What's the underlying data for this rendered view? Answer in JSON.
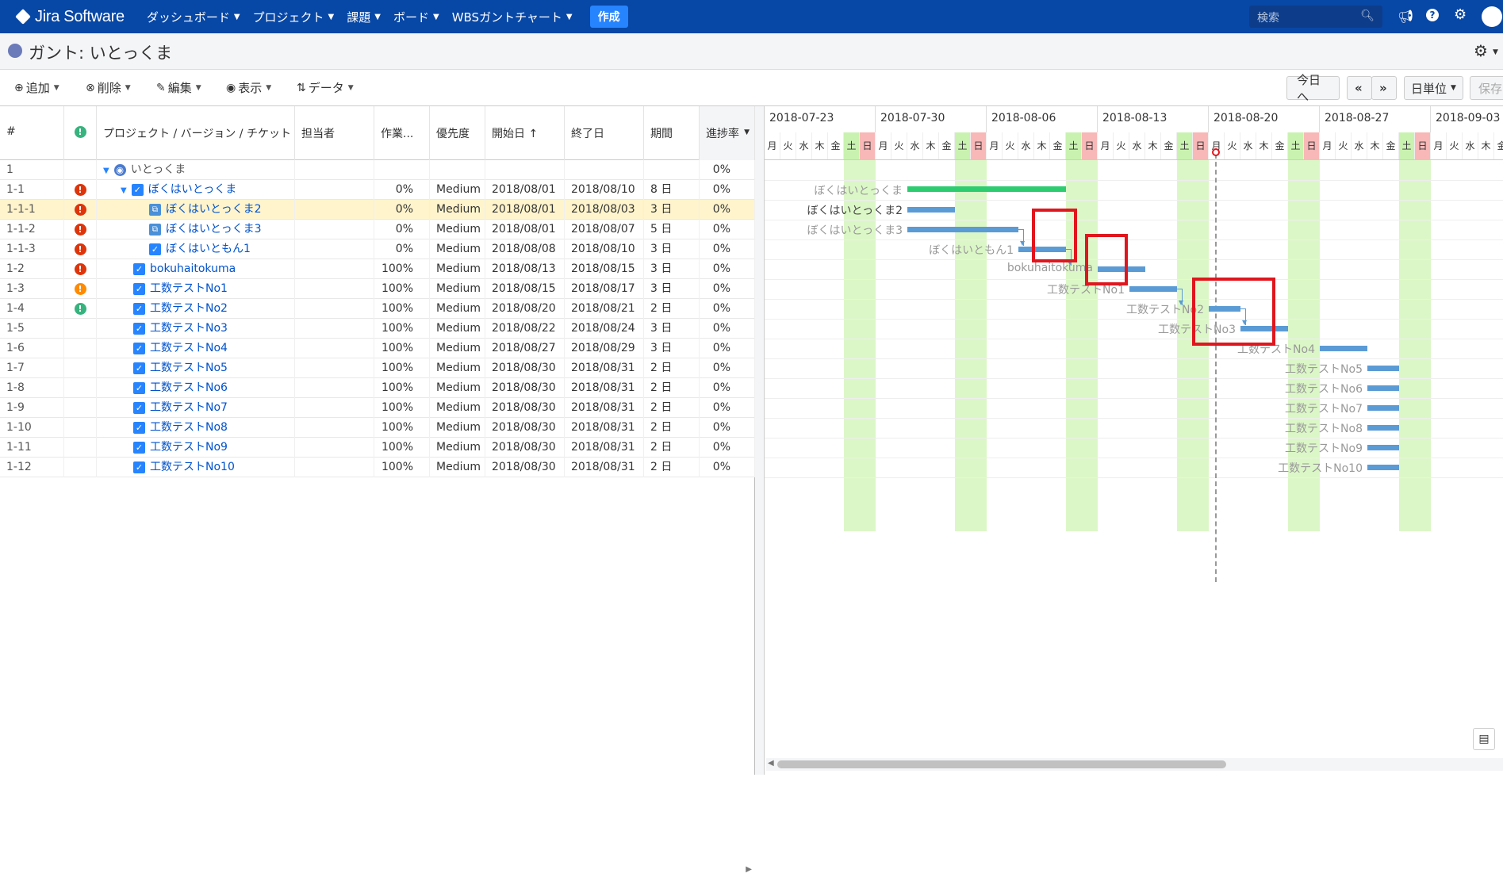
{
  "topnav": {
    "logo": "Jira Software",
    "menu": [
      "ダッシュボード",
      "プロジェクト",
      "課題",
      "ボード",
      "WBSガントチャート"
    ],
    "create": "作成",
    "search_placeholder": "検索"
  },
  "page": {
    "title": "ガント: いとっくま"
  },
  "toolbar": {
    "add": "追加",
    "delete": "削除",
    "edit": "編集",
    "view": "表示",
    "data": "データ",
    "today": "今日へ",
    "prev": "«",
    "next": "»",
    "unit": "日単位",
    "save": "保存"
  },
  "grid": {
    "headers": [
      "#",
      "",
      "プロジェクト / バージョン / チケット",
      "担当者",
      "作業...",
      "優先度",
      "開始日 ↑",
      "終了日",
      "期間",
      "進捗率"
    ],
    "rows": [
      {
        "id": "1",
        "prio": "",
        "name": "いとっくま",
        "icon": "project",
        "indent": 0,
        "work": "",
        "priority": "",
        "start": "",
        "end": "",
        "dur": "",
        "prog": "0%"
      },
      {
        "id": "1-1",
        "prio": "red",
        "name": "ぼくはいとっくま",
        "icon": "check",
        "indent": 1,
        "work": "0%",
        "priority": "Medium",
        "start": "2018/08/01",
        "end": "2018/08/10",
        "dur": "8 日",
        "prog": "0%"
      },
      {
        "id": "1-1-1",
        "prio": "red",
        "name": "ぼくはいとっくま2",
        "icon": "sub",
        "indent": 2,
        "work": "0%",
        "priority": "Medium",
        "start": "2018/08/01",
        "end": "2018/08/03",
        "dur": "3 日",
        "prog": "0%"
      },
      {
        "id": "1-1-2",
        "prio": "red",
        "name": "ぼくはいとっくま3",
        "icon": "sub",
        "indent": 2,
        "work": "0%",
        "priority": "Medium",
        "start": "2018/08/01",
        "end": "2018/08/07",
        "dur": "5 日",
        "prog": "0%"
      },
      {
        "id": "1-1-3",
        "prio": "red",
        "name": "ぼくはいともん1",
        "icon": "check",
        "indent": 2,
        "work": "0%",
        "priority": "Medium",
        "start": "2018/08/08",
        "end": "2018/08/10",
        "dur": "3 日",
        "prog": "0%"
      },
      {
        "id": "1-2",
        "prio": "red",
        "name": "bokuhaitokuma",
        "icon": "check",
        "indent": 1,
        "work": "100%",
        "priority": "Medium",
        "start": "2018/08/13",
        "end": "2018/08/15",
        "dur": "3 日",
        "prog": "0%"
      },
      {
        "id": "1-3",
        "prio": "orange",
        "name": "工数テストNo1",
        "icon": "check",
        "indent": 1,
        "work": "100%",
        "priority": "Medium",
        "start": "2018/08/15",
        "end": "2018/08/17",
        "dur": "3 日",
        "prog": "0%"
      },
      {
        "id": "1-4",
        "prio": "green",
        "name": "工数テストNo2",
        "icon": "check",
        "indent": 1,
        "work": "100%",
        "priority": "Medium",
        "start": "2018/08/20",
        "end": "2018/08/21",
        "dur": "2 日",
        "prog": "0%"
      },
      {
        "id": "1-5",
        "prio": "",
        "name": "工数テストNo3",
        "icon": "check",
        "indent": 1,
        "work": "100%",
        "priority": "Medium",
        "start": "2018/08/22",
        "end": "2018/08/24",
        "dur": "3 日",
        "prog": "0%"
      },
      {
        "id": "1-6",
        "prio": "",
        "name": "工数テストNo4",
        "icon": "check",
        "indent": 1,
        "work": "100%",
        "priority": "Medium",
        "start": "2018/08/27",
        "end": "2018/08/29",
        "dur": "3 日",
        "prog": "0%"
      },
      {
        "id": "1-7",
        "prio": "",
        "name": "工数テストNo5",
        "icon": "check",
        "indent": 1,
        "work": "100%",
        "priority": "Medium",
        "start": "2018/08/30",
        "end": "2018/08/31",
        "dur": "2 日",
        "prog": "0%"
      },
      {
        "id": "1-8",
        "prio": "",
        "name": "工数テストNo6",
        "icon": "check",
        "indent": 1,
        "work": "100%",
        "priority": "Medium",
        "start": "2018/08/30",
        "end": "2018/08/31",
        "dur": "2 日",
        "prog": "0%"
      },
      {
        "id": "1-9",
        "prio": "",
        "name": "工数テストNo7",
        "icon": "check",
        "indent": 1,
        "work": "100%",
        "priority": "Medium",
        "start": "2018/08/30",
        "end": "2018/08/31",
        "dur": "2 日",
        "prog": "0%"
      },
      {
        "id": "1-10",
        "prio": "",
        "name": "工数テストNo8",
        "icon": "check",
        "indent": 1,
        "work": "100%",
        "priority": "Medium",
        "start": "2018/08/30",
        "end": "2018/08/31",
        "dur": "2 日",
        "prog": "0%"
      },
      {
        "id": "1-11",
        "prio": "",
        "name": "工数テストNo9",
        "icon": "check",
        "indent": 1,
        "work": "100%",
        "priority": "Medium",
        "start": "2018/08/30",
        "end": "2018/08/31",
        "dur": "2 日",
        "prog": "0%"
      },
      {
        "id": "1-12",
        "prio": "",
        "name": "工数テストNo10",
        "icon": "check",
        "indent": 1,
        "work": "100%",
        "priority": "Medium",
        "start": "2018/08/30",
        "end": "2018/08/31",
        "dur": "2 日",
        "prog": "0%"
      }
    ]
  },
  "gantt": {
    "weeks": [
      "2018-07-23",
      "2018-07-30",
      "2018-08-06",
      "2018-08-13",
      "2018-08-20",
      "2018-08-27",
      "2018-09-03"
    ],
    "daynames": [
      "月",
      "火",
      "水",
      "木",
      "金",
      "土",
      "日"
    ],
    "labels": [
      "ぼくはいとっくま",
      "ぼくはいとっくま2",
      "ぼくはいとっくま3",
      "ぼくはいともん1",
      "bokuhaitokuma",
      "工数テストNo1",
      "工数テストNo2",
      "工数テストNo3",
      "工数テストNo4",
      "工数テストNo5",
      "工数テストNo6",
      "工数テストNo7",
      "工数テストNo8",
      "工数テストNo9",
      "工数テストNo10"
    ],
    "today": "2018-08-20"
  },
  "colors": {
    "nav": "#0747a6",
    "accent": "#2684ff",
    "sat": "#c9f2b0",
    "sun": "#f8b8b8",
    "bar": "#5b9bd5",
    "summary": "#2ecc71",
    "highlight": "#e0161e"
  }
}
